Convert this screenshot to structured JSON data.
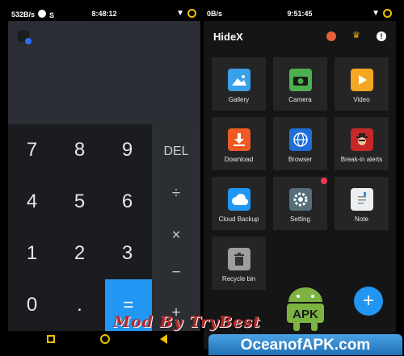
{
  "left_phone": {
    "status": {
      "net_speed": "532B/s",
      "time": "8:48:12"
    },
    "keys": [
      {
        "label": "7"
      },
      {
        "label": "8"
      },
      {
        "label": "9"
      },
      {
        "label": "4"
      },
      {
        "label": "5"
      },
      {
        "label": "6"
      },
      {
        "label": "1"
      },
      {
        "label": "2"
      },
      {
        "label": "3"
      },
      {
        "label": "0"
      },
      {
        "label": "."
      },
      {
        "label": "="
      }
    ],
    "ops": [
      "DEL",
      "÷",
      "×",
      "−",
      "+"
    ]
  },
  "right_phone": {
    "status": {
      "net_speed": "0B/s",
      "time": "9:51:45"
    },
    "app_title": "HideX",
    "tiles": [
      {
        "label": "Gallery",
        "icon": "gallery-icon",
        "color": "#3aa0e8"
      },
      {
        "label": "Camera",
        "icon": "camera-icon",
        "color": "#4caf50"
      },
      {
        "label": "Video",
        "icon": "video-icon",
        "color": "#f5a623"
      },
      {
        "label": "Download",
        "icon": "download-icon",
        "color": "#ef5a24"
      },
      {
        "label": "Browser",
        "icon": "browser-icon",
        "color": "#1e6fd9"
      },
      {
        "label": "Break-in alerts",
        "icon": "spy-icon",
        "color": "#c62828"
      },
      {
        "label": "Cloud Backup",
        "icon": "cloud-icon",
        "color": "#2196f3"
      },
      {
        "label": "Setting",
        "icon": "gear-icon",
        "color": "#546e7a"
      },
      {
        "label": "Note",
        "icon": "note-icon",
        "color": "#eceff1"
      },
      {
        "label": "Recycle bin",
        "icon": "trash-icon",
        "color": "#9e9e9e"
      }
    ],
    "fab_label": "+"
  },
  "watermark": {
    "mod_text": "Mod By TryBest",
    "apk_badge": "APK",
    "site": "OceanofAPK.com"
  }
}
